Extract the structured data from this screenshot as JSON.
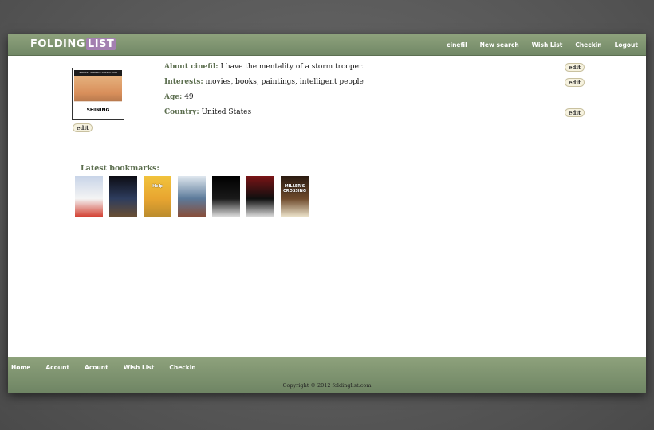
{
  "header": {
    "logo_part1": "FOLDING",
    "logo_part2": "LIST",
    "nav": [
      "cinefil",
      "New search",
      "Wish List",
      "Checkin",
      "Logout"
    ]
  },
  "profile": {
    "image_title": "SHINING",
    "image_header": "STANLEY KUBRICK COLLECTION",
    "edit_label": "edit",
    "fields": [
      {
        "label": "About cinefil:",
        "value": "I have the mentality of a storm trooper.",
        "editable": true
      },
      {
        "label": "Interests:",
        "value": "movies, books, paintings, intelligent people",
        "editable": true
      },
      {
        "label": "Age:",
        "value": "49",
        "editable": false
      },
      {
        "label": "Country:",
        "value": "United States",
        "editable": true
      }
    ]
  },
  "bookmarks": {
    "heading": "Latest bookmarks:",
    "posters": [
      {
        "name": "poster-1",
        "colors": [
          "#c8d4e8",
          "#f4f4f4",
          "#d23a2c"
        ]
      },
      {
        "name": "poster-2",
        "colors": [
          "#0c0c14",
          "#2e3d5e",
          "#6b4f32"
        ]
      },
      {
        "name": "poster-helps",
        "colors": [
          "#f1c33d",
          "#e8a530",
          "#b98b2e"
        ]
      },
      {
        "name": "poster-4",
        "colors": [
          "#dfe7ee",
          "#5c7a9a",
          "#8a4c36"
        ]
      },
      {
        "name": "poster-godfather",
        "colors": [
          "#000000",
          "#1a1a1a",
          "#e4e4e4"
        ]
      },
      {
        "name": "poster-6",
        "colors": [
          "#7a1416",
          "#0f0f0f",
          "#e2e2e2"
        ]
      },
      {
        "name": "poster-millers-crossing",
        "colors": [
          "#2a1a10",
          "#6e4a2c",
          "#f0e8d0"
        ]
      }
    ],
    "poster_texts": [
      "",
      "",
      "Help",
      "",
      "",
      "",
      "MILLER'S CROSSING"
    ]
  },
  "footer": {
    "nav": [
      "Home",
      "Acount",
      "Acount",
      "Wish List",
      "Checkin"
    ],
    "copyright": "Copyright © 2012 foldinglist.com"
  }
}
